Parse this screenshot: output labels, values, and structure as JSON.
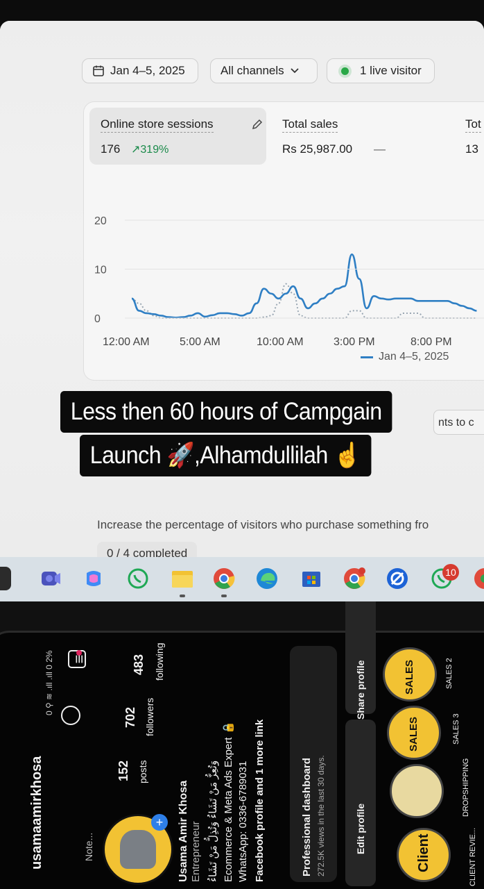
{
  "filters": {
    "date": "Jan 4–5, 2025",
    "channels": "All channels",
    "live": "1 live visitor"
  },
  "metrics": [
    {
      "title": "Online store sessions",
      "value": "176",
      "trend": "319%"
    },
    {
      "title": "Total sales",
      "value": "Rs 25,987.00",
      "trend": "—"
    },
    {
      "title": "Tot",
      "value": "13"
    }
  ],
  "chart_data": {
    "type": "line",
    "x_ticks": [
      "12:00 AM",
      "5:00 AM",
      "10:00 AM",
      "3:00 PM",
      "8:00 PM"
    ],
    "y_ticks": [
      "20",
      "10",
      "0"
    ],
    "ylim": [
      0,
      20
    ],
    "series": [
      {
        "name": "Jan 4–5, 2025",
        "style": "solid",
        "color": "#2f7fc4",
        "x_hours": [
          0,
          0.5,
          1,
          1.5,
          2,
          2.5,
          3,
          3.5,
          4,
          4.5,
          5,
          5.5,
          6,
          6.5,
          7,
          7.5,
          8,
          8.5,
          9,
          9.5,
          10,
          10.5,
          11,
          11.5,
          12,
          12.5,
          13,
          13.5,
          14,
          14.5,
          15,
          15.5,
          16,
          16.5,
          17,
          17.5,
          18,
          18.5,
          19,
          19.5,
          20,
          20.5,
          21,
          21.5,
          22,
          22.5,
          23,
          23.5
        ],
        "values": [
          4,
          1.5,
          1,
          0.8,
          0.5,
          0.2,
          0.1,
          0.2,
          0.5,
          1,
          0.3,
          0.6,
          1,
          1,
          0.8,
          0.5,
          1,
          3,
          6,
          5,
          4,
          5,
          6.5,
          4,
          2,
          3,
          4,
          5,
          6,
          6.5,
          13,
          8,
          2,
          4.5,
          4,
          3.8,
          4,
          4,
          4,
          3.5,
          3.5,
          3.5,
          3.5,
          3.5,
          3,
          2.5,
          2,
          1.5
        ]
      },
      {
        "name": "comparison",
        "style": "dotted",
        "color": "#9aa7b3",
        "x_hours": [
          0,
          0.5,
          1,
          1.5,
          2,
          2.5,
          3,
          3.5,
          4,
          4.5,
          5,
          5.5,
          6,
          6.5,
          7,
          7.5,
          8,
          8.5,
          9,
          9.5,
          10,
          10.5,
          11,
          11.5,
          12,
          12.5,
          13,
          13.5,
          14,
          14.5,
          15,
          15.5,
          16,
          16.5,
          17,
          17.5,
          18,
          18.5,
          19,
          19.5,
          20,
          20.5,
          21,
          21.5,
          22,
          22.5,
          23,
          23.5
        ],
        "values": [
          4,
          3,
          1.5,
          0.5,
          0,
          0,
          0,
          0,
          0,
          0,
          0,
          0,
          0,
          0,
          0,
          0,
          0,
          0,
          0.2,
          0.5,
          3,
          7,
          5,
          0.5,
          0,
          0,
          0,
          0,
          0,
          0,
          1.5,
          1.5,
          0,
          0,
          0,
          0,
          0,
          1,
          1,
          1,
          0,
          0,
          0,
          0,
          0,
          0,
          0,
          0
        ]
      }
    ],
    "legend": "bottom-right"
  },
  "legend_label": "Jan 4–5, 2025",
  "overlay": {
    "line1": "Less then 60 hours of Campgain",
    "line2": "Launch 🚀,Alhamdullilah ☝"
  },
  "hint": "nts to c",
  "setup": {
    "description": "Increase the percentage of visitors who purchase something fro",
    "progress": "0 / 4 completed"
  },
  "taskbar": {
    "whatsapp_badge": "10"
  },
  "profile": {
    "status_bar": "0 ⚲ ≋ .ıll .ıll 0 2%",
    "username": "usamaamirkhosa",
    "posts": "152",
    "posts_label": "posts",
    "followers": "702",
    "followers_label": "followers",
    "following": "483",
    "following_label": "following",
    "note": "Note...",
    "name": "Usama Amir Khosa",
    "category": "Entrepreneur",
    "bio_arabic": "وَتُعِزُّ مَنْ تَشَاءُ وَتُذِلُّ مَنْ تَشَاءُ",
    "bio_line": "Ecommerce & Meta Ads Expert 🔒",
    "whatsapp": "WhatsApp: 0336-6789031",
    "links": "Facebook profile and 1 more link",
    "dashboard_title": "Professional dashboard",
    "dashboard_sub": "272.5K views in the last 30 days.",
    "edit_profile": "Edit profile",
    "share_profile": "Share profile",
    "highlights": [
      "SALES 2",
      "SALES 3",
      "DROPSHIPPING",
      "CLIENT REVIE..."
    ]
  }
}
